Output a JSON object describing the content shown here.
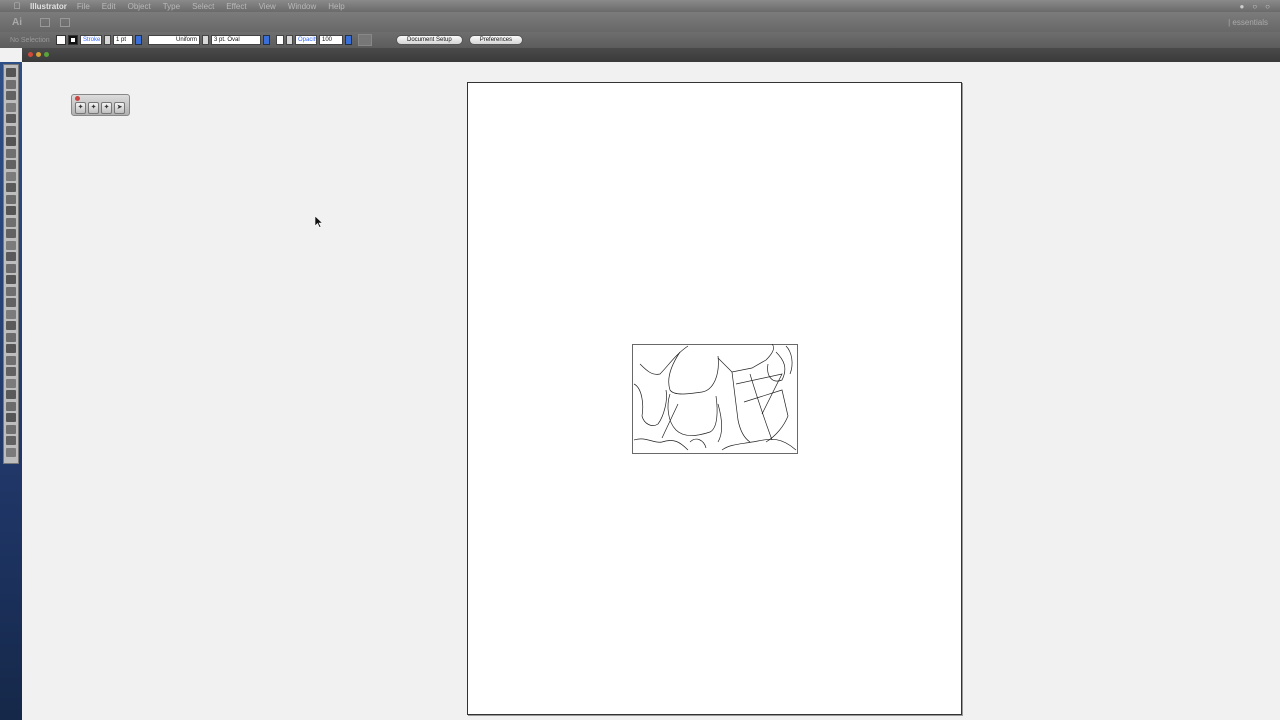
{
  "menubar": {
    "app_name": "Illustrator",
    "items": [
      "File",
      "Edit",
      "Object",
      "Type",
      "Select",
      "Effect",
      "View",
      "Window",
      "Help"
    ]
  },
  "appbar": {
    "logo": "Ai",
    "right_text": "|  essentials"
  },
  "controlbar": {
    "selection_label": "No Selection",
    "stroke_label": "Stroke",
    "stroke_weight": "1 pt",
    "stroke_profile": "Uniform",
    "brush": "3 pt. Oval",
    "opacity_label": "Opacity",
    "opacity_value": "100",
    "document_setup_label": "Document Setup",
    "preferences_label": "Preferences"
  },
  "colors": {
    "menubar": "#7a7a7a",
    "tools_bg": "#1e3463",
    "pasteboard": "#f1f1f1",
    "artboard": "#ffffff",
    "accent_blue": "#3a6fd8"
  }
}
